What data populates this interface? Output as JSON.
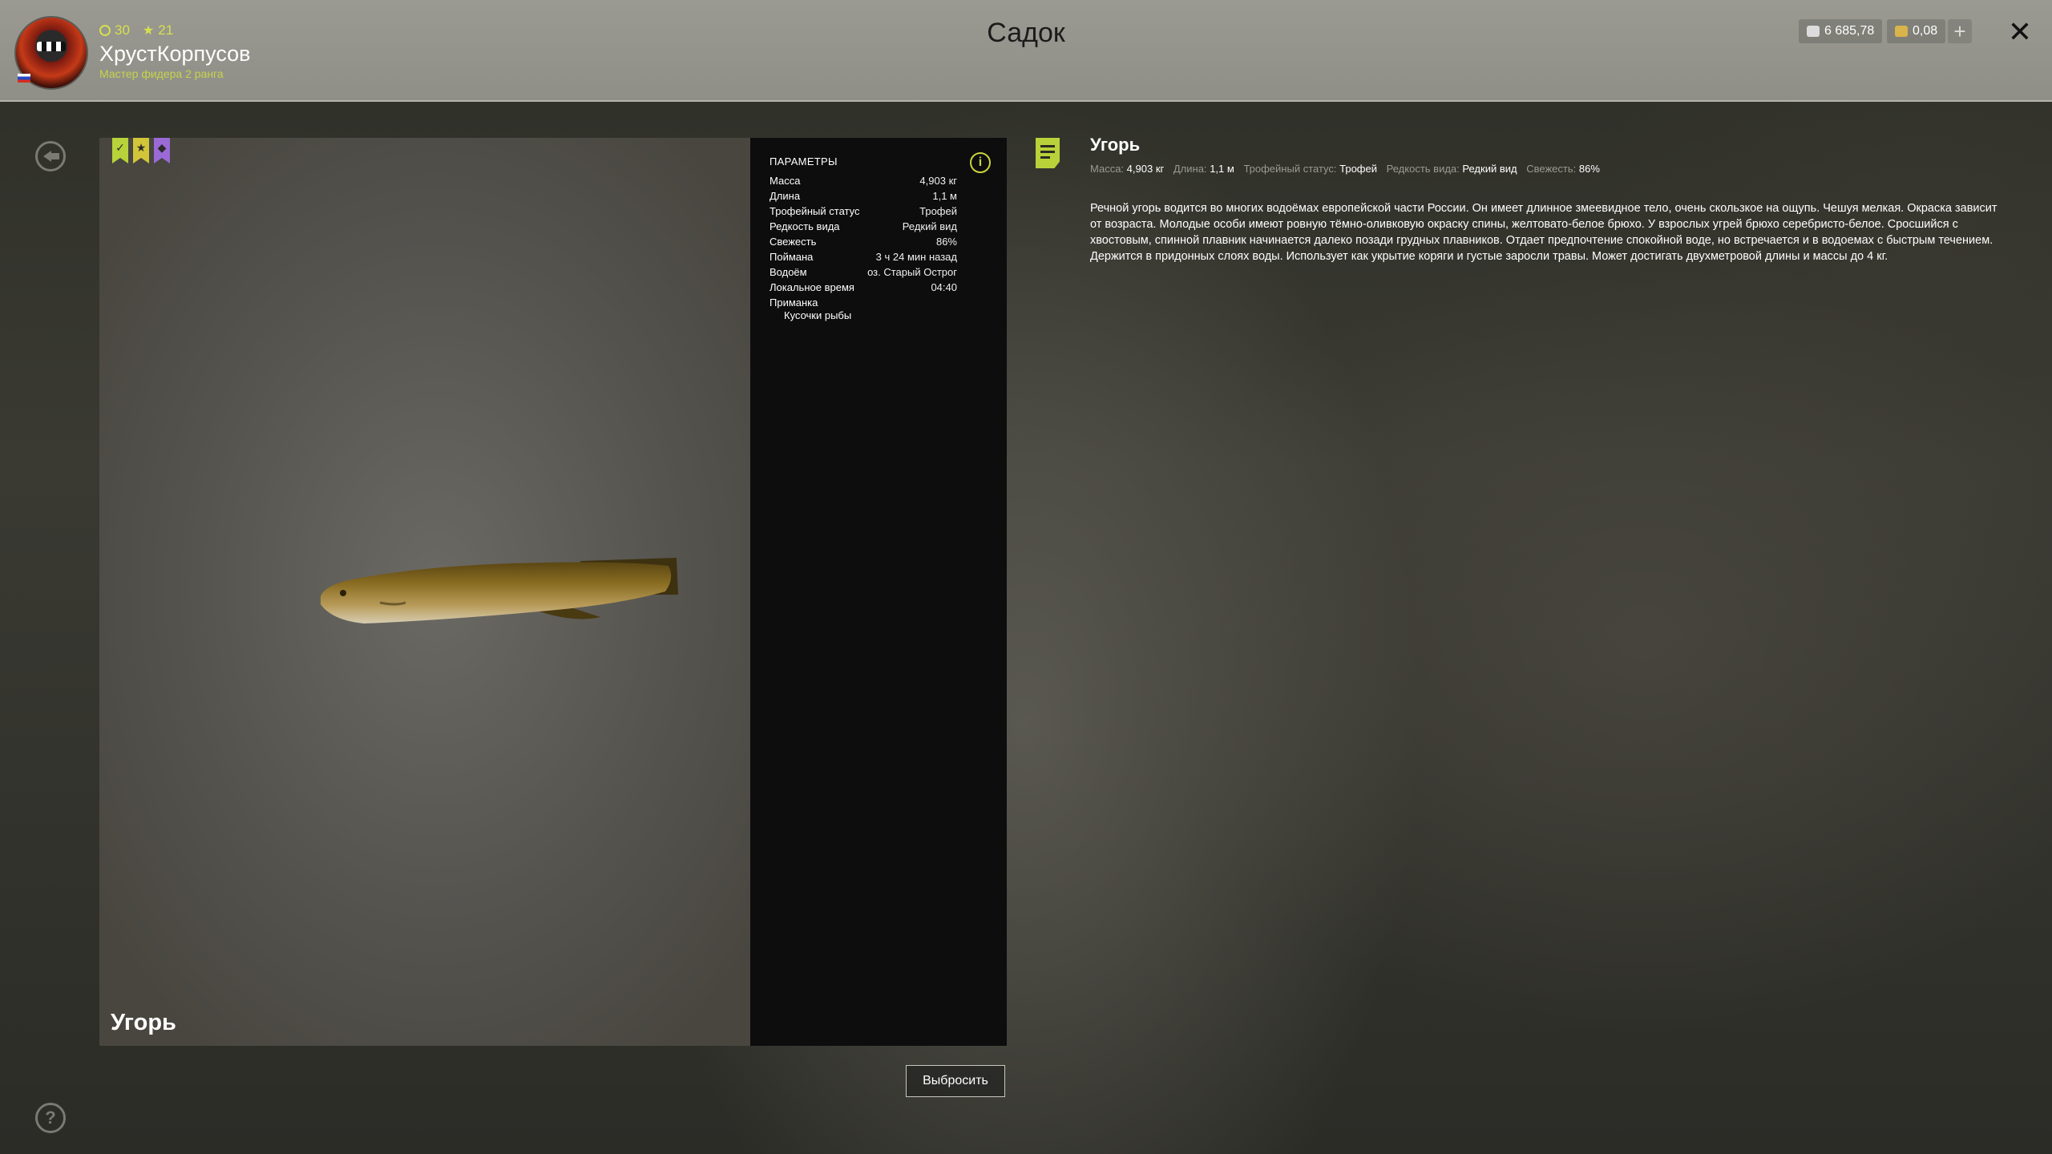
{
  "header": {
    "title": "Садок",
    "user": {
      "level": "30",
      "stars": "21",
      "name": "ХрустКорпусов",
      "rank": "Мастер фидера 2 ранга"
    },
    "currency": {
      "silver": "6 685,78",
      "gold": "0,08",
      "add_label": "+"
    },
    "close_label": "✕"
  },
  "viewer": {
    "fish_name": "Угорь",
    "badges": [
      "✓",
      "★",
      "◆"
    ]
  },
  "params": {
    "heading": "ПАРАМЕТРЫ",
    "info_label": "i",
    "rows": [
      {
        "label": "Масса",
        "value": "4,903 кг"
      },
      {
        "label": "Длина",
        "value": "1,1 м"
      },
      {
        "label": "Трофейный статус",
        "value": "Трофей"
      },
      {
        "label": "Редкость вида",
        "value": "Редкий вид"
      },
      {
        "label": "Свежесть",
        "value": "86%"
      },
      {
        "label": "Поймана",
        "value": "3 ч 24 мин назад"
      },
      {
        "label": "Водоём",
        "value": "оз. Старый Острог"
      },
      {
        "label": "Локальное время",
        "value": "04:40"
      },
      {
        "label": "Приманка",
        "value": ""
      }
    ],
    "bait": "Кусочки рыбы"
  },
  "actions": {
    "discard": "Выбросить"
  },
  "description": {
    "title": "Угорь",
    "stats": [
      {
        "label": "Масса:",
        "value": "4,903 кг"
      },
      {
        "label": "Длина:",
        "value": "1,1 м"
      },
      {
        "label": "Трофейный статус:",
        "value": "Трофей"
      },
      {
        "label": "Редкость вида:",
        "value": "Редкий вид"
      },
      {
        "label": "Свежесть:",
        "value": "86%"
      }
    ],
    "text": "Речной угорь водится во многих водоёмах европейской части России. Он имеет длинное змеевидное тело, очень скользкое на ощупь. Чешуя мелкая. Окраска зависит от возраста. Молодые особи имеют ровную тёмно-оливковую окраску спины, желтовато-белое брюхо. У взрослых угрей брюхо серебристо-белое. Сросшийся с хвостовым, спинной плавник начинается далеко позади грудных плавников. Отдает предпочтение спокойной воде, но встречается и в водоемах с быстрым течением. Держится в придонных слоях воды. Использует как укрытие коряги и густые заросли травы. Может достигать двухметровой длины и массы до 4 кг."
  },
  "colors": {
    "accent": "#c9d43c",
    "header_bg": "#9a9a92",
    "panel_bg": "#0d0d0d"
  }
}
